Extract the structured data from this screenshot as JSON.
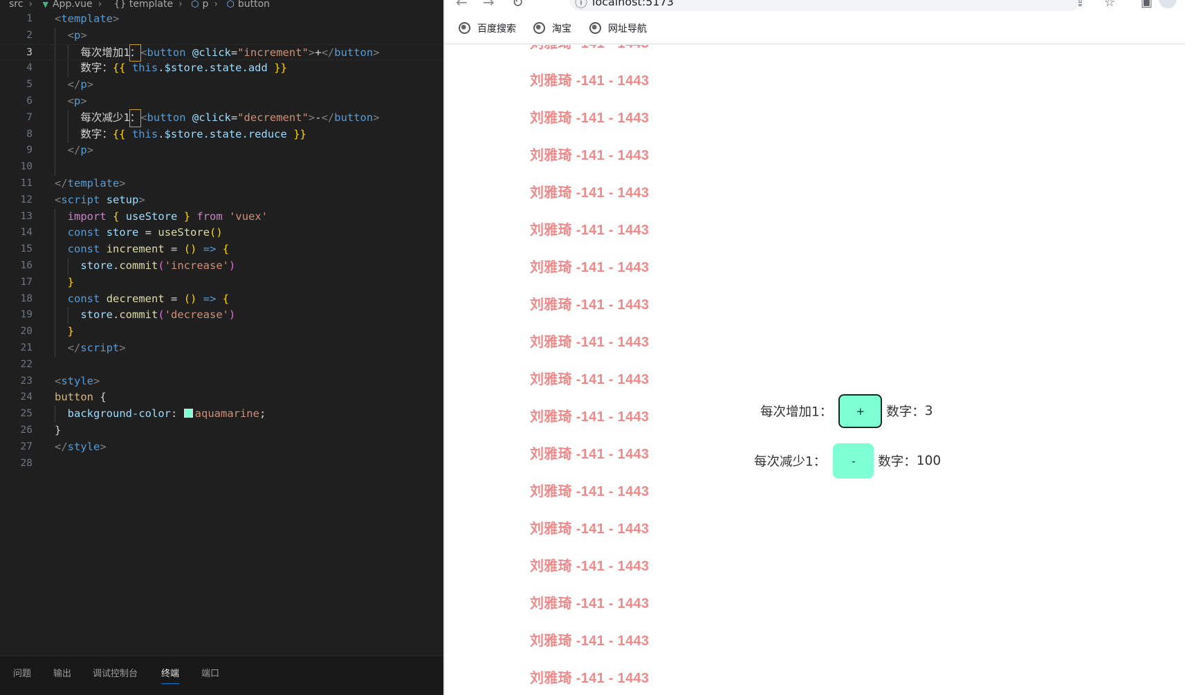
{
  "editor": {
    "breadcrumb": [
      "src",
      "App.vue",
      "{} template",
      "p",
      "button"
    ],
    "lines": [
      {
        "n": "1"
      },
      {
        "n": "2"
      },
      {
        "n": "3"
      },
      {
        "n": "4"
      },
      {
        "n": "5"
      },
      {
        "n": "6"
      },
      {
        "n": "7"
      },
      {
        "n": "8"
      },
      {
        "n": "9"
      },
      {
        "n": "10"
      },
      {
        "n": "11"
      },
      {
        "n": "12"
      },
      {
        "n": "13"
      },
      {
        "n": "14"
      },
      {
        "n": "15"
      },
      {
        "n": "16"
      },
      {
        "n": "17"
      },
      {
        "n": "18"
      },
      {
        "n": "19"
      },
      {
        "n": "20"
      },
      {
        "n": "21"
      },
      {
        "n": "22"
      },
      {
        "n": "23"
      },
      {
        "n": "24"
      },
      {
        "n": "25"
      },
      {
        "n": "26"
      },
      {
        "n": "27"
      },
      {
        "n": "28"
      }
    ],
    "code": {
      "l1_tag": "template",
      "l3_text": "每次增加1",
      "l3_colon": "：",
      "l3_attr": "@click",
      "l3_val": "\"increment\"",
      "l3_plus": "+",
      "l4_label": "数字：",
      "l4_expr": "$store.state.add",
      "l7_text": "每次减少1",
      "l7_val": "\"decrement\"",
      "l7_minus": "-",
      "l8_expr": "$store.state.reduce",
      "l13_fn": "useStore",
      "l13_mod": "'vuex'",
      "l14_var": "store",
      "l15_var": "increment",
      "l16_str": "'increase'",
      "l18_var": "decrement",
      "l19_str": "'decrease'",
      "l25_val": "aquamarine"
    },
    "panel_tabs": [
      "问题",
      "输出",
      "调试控制台",
      "终端",
      "端口"
    ],
    "active_panel_tab": "终端"
  },
  "browser": {
    "url": "localhost:5173",
    "bookmarks": [
      "百度搜索",
      "淘宝",
      "网址导航"
    ],
    "watermark": "刘雅琦 -141 - 1443",
    "row1": {
      "label": "每次增加1：",
      "button": "+",
      "count_label": "数字：",
      "count": "3"
    },
    "row2": {
      "label": "每次减少1：",
      "button": "-",
      "count_label": "数字：",
      "count": "100"
    },
    "button_color": "#7fffd4"
  }
}
